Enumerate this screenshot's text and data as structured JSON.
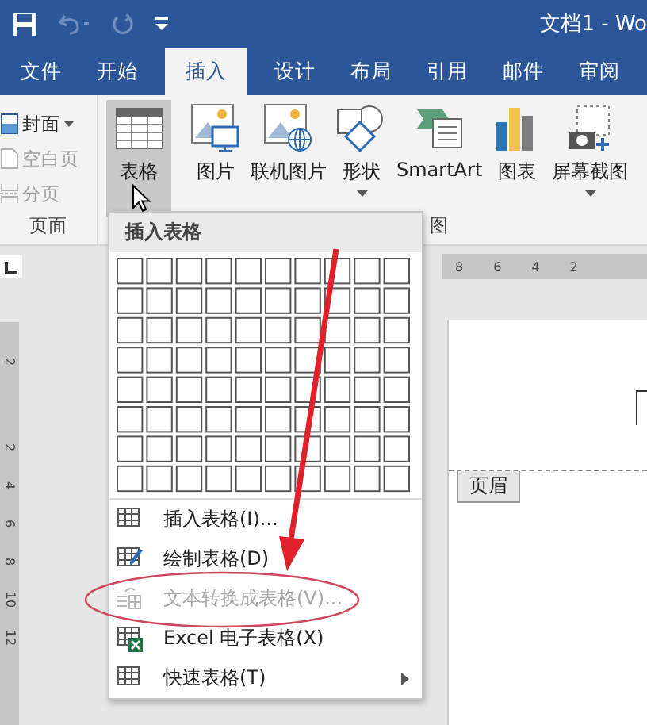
{
  "title_bar": {
    "title": "文档1 - Wo",
    "quick_access": [
      {
        "kind": "save",
        "disabled": false
      },
      {
        "kind": "undo",
        "disabled": true
      },
      {
        "kind": "redo",
        "disabled": true
      },
      {
        "kind": "customize",
        "disabled": false
      }
    ]
  },
  "tabs": [
    {
      "label": "文件",
      "selected": false
    },
    {
      "label": "开始",
      "selected": false
    },
    {
      "label": "插入",
      "selected": true
    },
    {
      "label": "设计",
      "selected": false
    },
    {
      "label": "布局",
      "selected": false
    },
    {
      "label": "引用",
      "selected": false
    },
    {
      "label": "邮件",
      "selected": false
    },
    {
      "label": "审阅",
      "selected": false
    }
  ],
  "ribbon": {
    "pages_group": {
      "label": "页面",
      "items": [
        {
          "kind": "cover",
          "label": "封面",
          "dropdown": true,
          "disabled": false
        },
        {
          "kind": "blank",
          "label": "空白页",
          "dropdown": false,
          "disabled": true
        },
        {
          "kind": "break",
          "label": "分页",
          "dropdown": false,
          "disabled": true
        }
      ]
    },
    "table_button": {
      "label": "表格",
      "selected": true
    },
    "illustrations_group": {
      "label": "图",
      "buttons": [
        {
          "kind": "picture",
          "label": "图片",
          "dropdown": false
        },
        {
          "kind": "online",
          "label": "联机图片",
          "dropdown": false
        },
        {
          "kind": "shapes",
          "label": "形状",
          "dropdown": true
        },
        {
          "kind": "smartart",
          "label": "SmartArt",
          "dropdown": false
        },
        {
          "kind": "chart",
          "label": "图表",
          "dropdown": false
        },
        {
          "kind": "screenshot",
          "label": "屏幕截图",
          "dropdown": true
        }
      ]
    }
  },
  "horizontal_ruler": [
    "8",
    "6",
    "4",
    "2"
  ],
  "vertical_ruler": [
    "2",
    "2",
    "4",
    "6",
    "8",
    "10",
    "12"
  ],
  "page": {
    "header_tag": "页眉"
  },
  "dropdown": {
    "header": "插入表格",
    "items": [
      {
        "kind": "insert",
        "label": "插入表格(I)...",
        "disabled": false,
        "submenu": false
      },
      {
        "kind": "draw",
        "label": "绘制表格(D)",
        "disabled": false,
        "submenu": false
      },
      {
        "kind": "convert",
        "label": "文本转换成表格(V)...",
        "disabled": true,
        "submenu": false
      },
      {
        "kind": "excel",
        "label": "Excel 电子表格(X)",
        "disabled": false,
        "submenu": false
      },
      {
        "kind": "quick",
        "label": "快速表格(T)",
        "disabled": false,
        "submenu": true
      }
    ]
  },
  "annotations": {
    "arrow": true,
    "highlight_ellipse": true
  }
}
